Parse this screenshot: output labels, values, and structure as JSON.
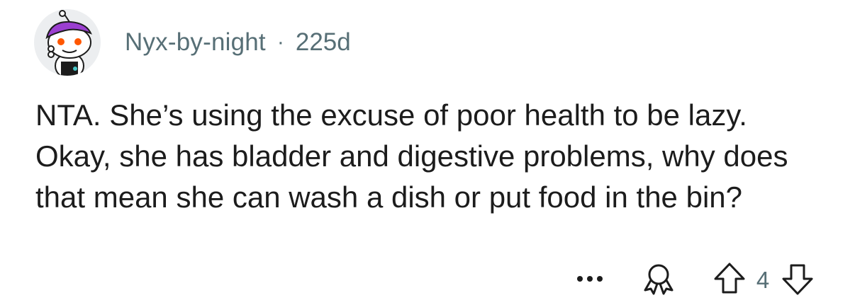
{
  "comment": {
    "author": "Nyx-by-night",
    "separator": "·",
    "age": "225d",
    "text": "NTA. She’s using the excuse of poor health to be lazy. Okay, she has bladder and digestive problems, why does that mean she can wash a dish or put food in the bin?",
    "score": "4"
  },
  "icons": {
    "avatar": "reddit-snoo-avatar",
    "more": "more-dots-icon",
    "award": "award-icon",
    "upvote": "upvote-arrow-icon",
    "downvote": "downvote-arrow-icon"
  },
  "colors": {
    "meta_text": "#576f76",
    "body_text": "#1c1c1c",
    "avatar_accent": "#9b3fd0"
  }
}
